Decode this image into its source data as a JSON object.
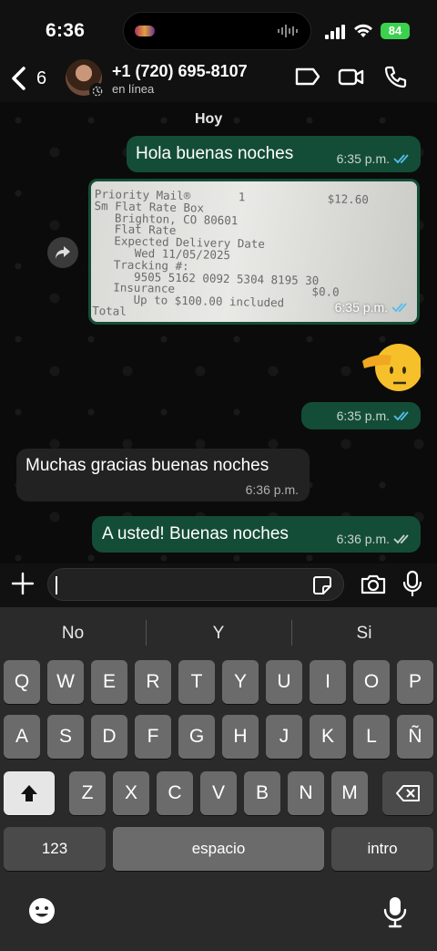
{
  "status": {
    "time": "6:36",
    "battery": "84"
  },
  "header": {
    "back_count": "6",
    "contact_name": "+1 (720) 695-8107",
    "contact_status": "en línea"
  },
  "chat": {
    "day_label": "Hoy",
    "messages": [
      {
        "direction": "out",
        "text": "Hola buenas noches",
        "time": "6:35 p.m.",
        "read": true
      },
      {
        "direction": "out",
        "type": "image",
        "time": "6:35 p.m.",
        "read": true,
        "receipt_lines": [
          "Priority Mail®       1            $12.60",
          "Sm Flat Rate Box",
          "   Brighton, CO 80601",
          "   Flat Rate",
          "   Expected Delivery Date",
          "      Wed 11/05/2025",
          "   Tracking #:",
          "      9505 5162 0092 5304 8195 30",
          "   Insurance                    $0.0",
          "      Up to $100.00 included",
          "Total"
        ]
      },
      {
        "direction": "out",
        "type": "emoji",
        "emoji": "saluting-face",
        "time": "6:35 p.m.",
        "read": true
      },
      {
        "direction": "in",
        "text": "Muchas gracias buenas noches",
        "time": "6:36 p.m."
      },
      {
        "direction": "out",
        "text": "A usted! Buenas noches",
        "time": "6:36 p.m.",
        "read": false
      }
    ]
  },
  "keyboard": {
    "suggestions": [
      "No",
      "Y",
      "Si"
    ],
    "row1": [
      "Q",
      "W",
      "E",
      "R",
      "T",
      "Y",
      "U",
      "I",
      "O",
      "P"
    ],
    "row2": [
      "A",
      "S",
      "D",
      "F",
      "G",
      "H",
      "J",
      "K",
      "L",
      "Ñ"
    ],
    "row3": [
      "Z",
      "X",
      "C",
      "V",
      "B",
      "N",
      "M"
    ],
    "numbers_key": "123",
    "space_key": "espacio",
    "return_key": "intro"
  },
  "colors": {
    "outgoing_bubble": "#144d37",
    "incoming_bubble": "#222222",
    "read_ticks": "#53bdeb",
    "battery": "#3bd14f"
  }
}
